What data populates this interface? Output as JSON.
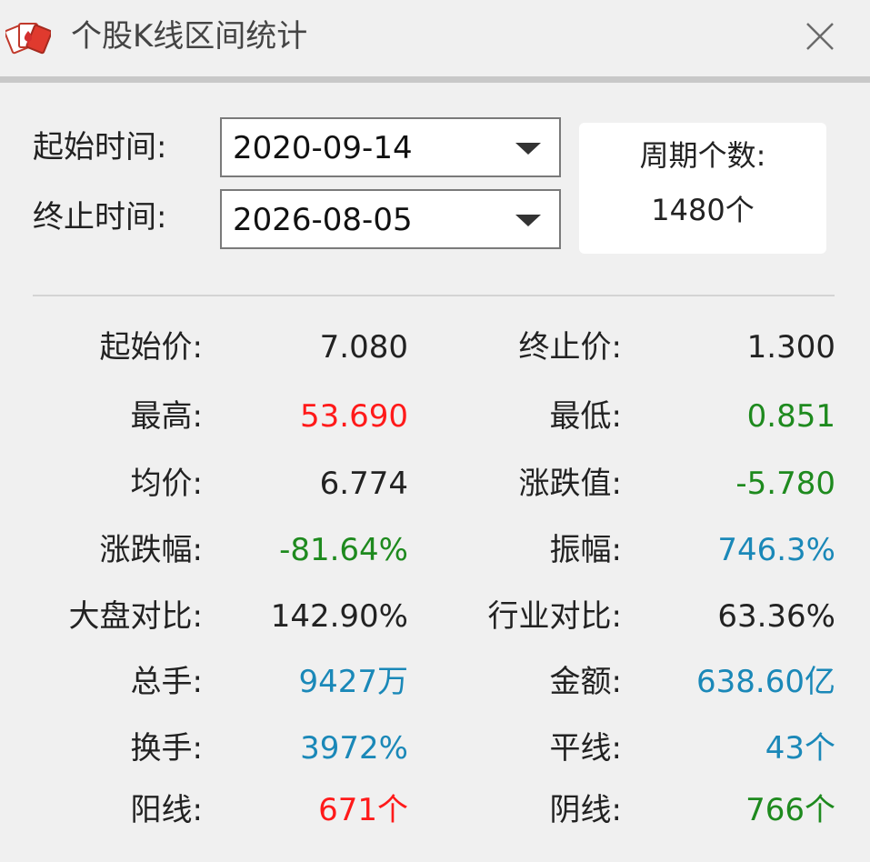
{
  "window": {
    "title": "个股K线区间统计",
    "icon": "cards-icon",
    "close_icon": "close-icon"
  },
  "range": {
    "start_label": "起始时间:",
    "start_value": "2020-09-14",
    "end_label": "终止时间:",
    "end_value": "2026-08-05",
    "period_label": "周期个数:",
    "period_value": "1480个"
  },
  "colors": {
    "default": "#222222",
    "up": "#ff1a1a",
    "down": "#1e8a1e",
    "info": "#1a88b8"
  },
  "stats": [
    {
      "left_label": "起始价:",
      "left_value": "7.080",
      "left_color": "default",
      "right_label": "终止价:",
      "right_value": "1.300",
      "right_color": "default"
    },
    {
      "left_label": "最高:",
      "left_value": "53.690",
      "left_color": "up",
      "right_label": "最低:",
      "right_value": "0.851",
      "right_color": "down"
    },
    {
      "left_label": "均价:",
      "left_value": "6.774",
      "left_color": "default",
      "right_label": "涨跌值:",
      "right_value": "-5.780",
      "right_color": "down"
    },
    {
      "left_label": "涨跌幅:",
      "left_value": "-81.64%",
      "left_color": "down",
      "right_label": "振幅:",
      "right_value": "746.3%",
      "right_color": "info"
    },
    {
      "left_label": "大盘对比:",
      "left_value": "142.90%",
      "left_color": "default",
      "right_label": "行业对比:",
      "right_value": "63.36%",
      "right_color": "default"
    },
    {
      "left_label": "总手:",
      "left_value": "9427万",
      "left_color": "info",
      "right_label": "金额:",
      "right_value": "638.60亿",
      "right_color": "info"
    },
    {
      "left_label": "换手:",
      "left_value": "3972%",
      "left_color": "info",
      "right_label": "平线:",
      "right_value": "43个",
      "right_color": "info"
    },
    {
      "left_label": "阳线:",
      "left_value": "671个",
      "left_color": "up",
      "right_label": "阴线:",
      "right_value": "766个",
      "right_color": "down"
    }
  ]
}
